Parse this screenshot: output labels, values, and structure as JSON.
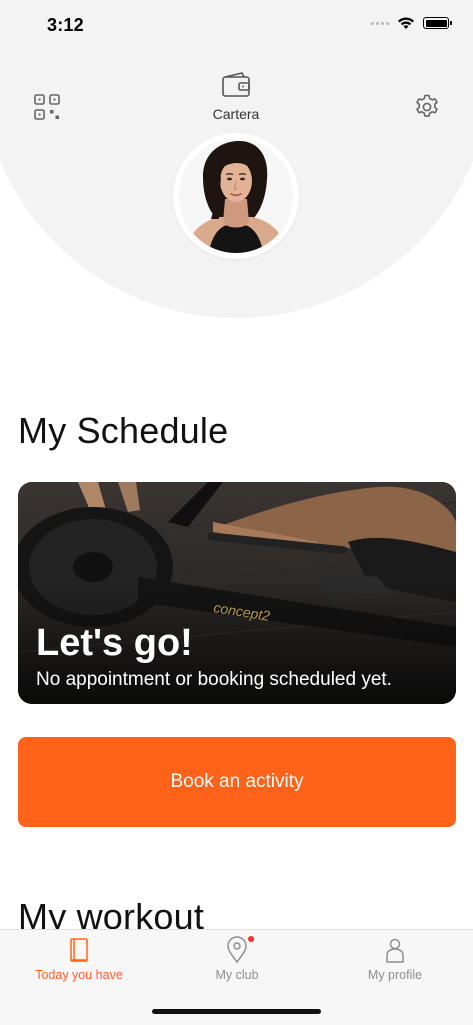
{
  "status_bar": {
    "time": "3:12"
  },
  "header": {
    "wallet_label": "Cartera",
    "icons": {
      "left": "qr-code-icon",
      "center": "wallet-icon",
      "right": "settings-gear-icon"
    }
  },
  "schedule": {
    "title": "My Schedule",
    "card_heading": "Let's go!",
    "card_subtitle": "No appointment or booking scheduled yet."
  },
  "book_button": {
    "label": "Book an activity",
    "color": "#ff6319"
  },
  "workout": {
    "title": "My workout"
  },
  "tab_bar": {
    "tabs": [
      {
        "label": "Today you have",
        "icon": "book-icon",
        "active": true
      },
      {
        "label": "My club",
        "icon": "location-pin-icon",
        "notification": true
      },
      {
        "label": "My profile",
        "icon": "person-icon"
      }
    ],
    "active_color": "#ff6319"
  }
}
